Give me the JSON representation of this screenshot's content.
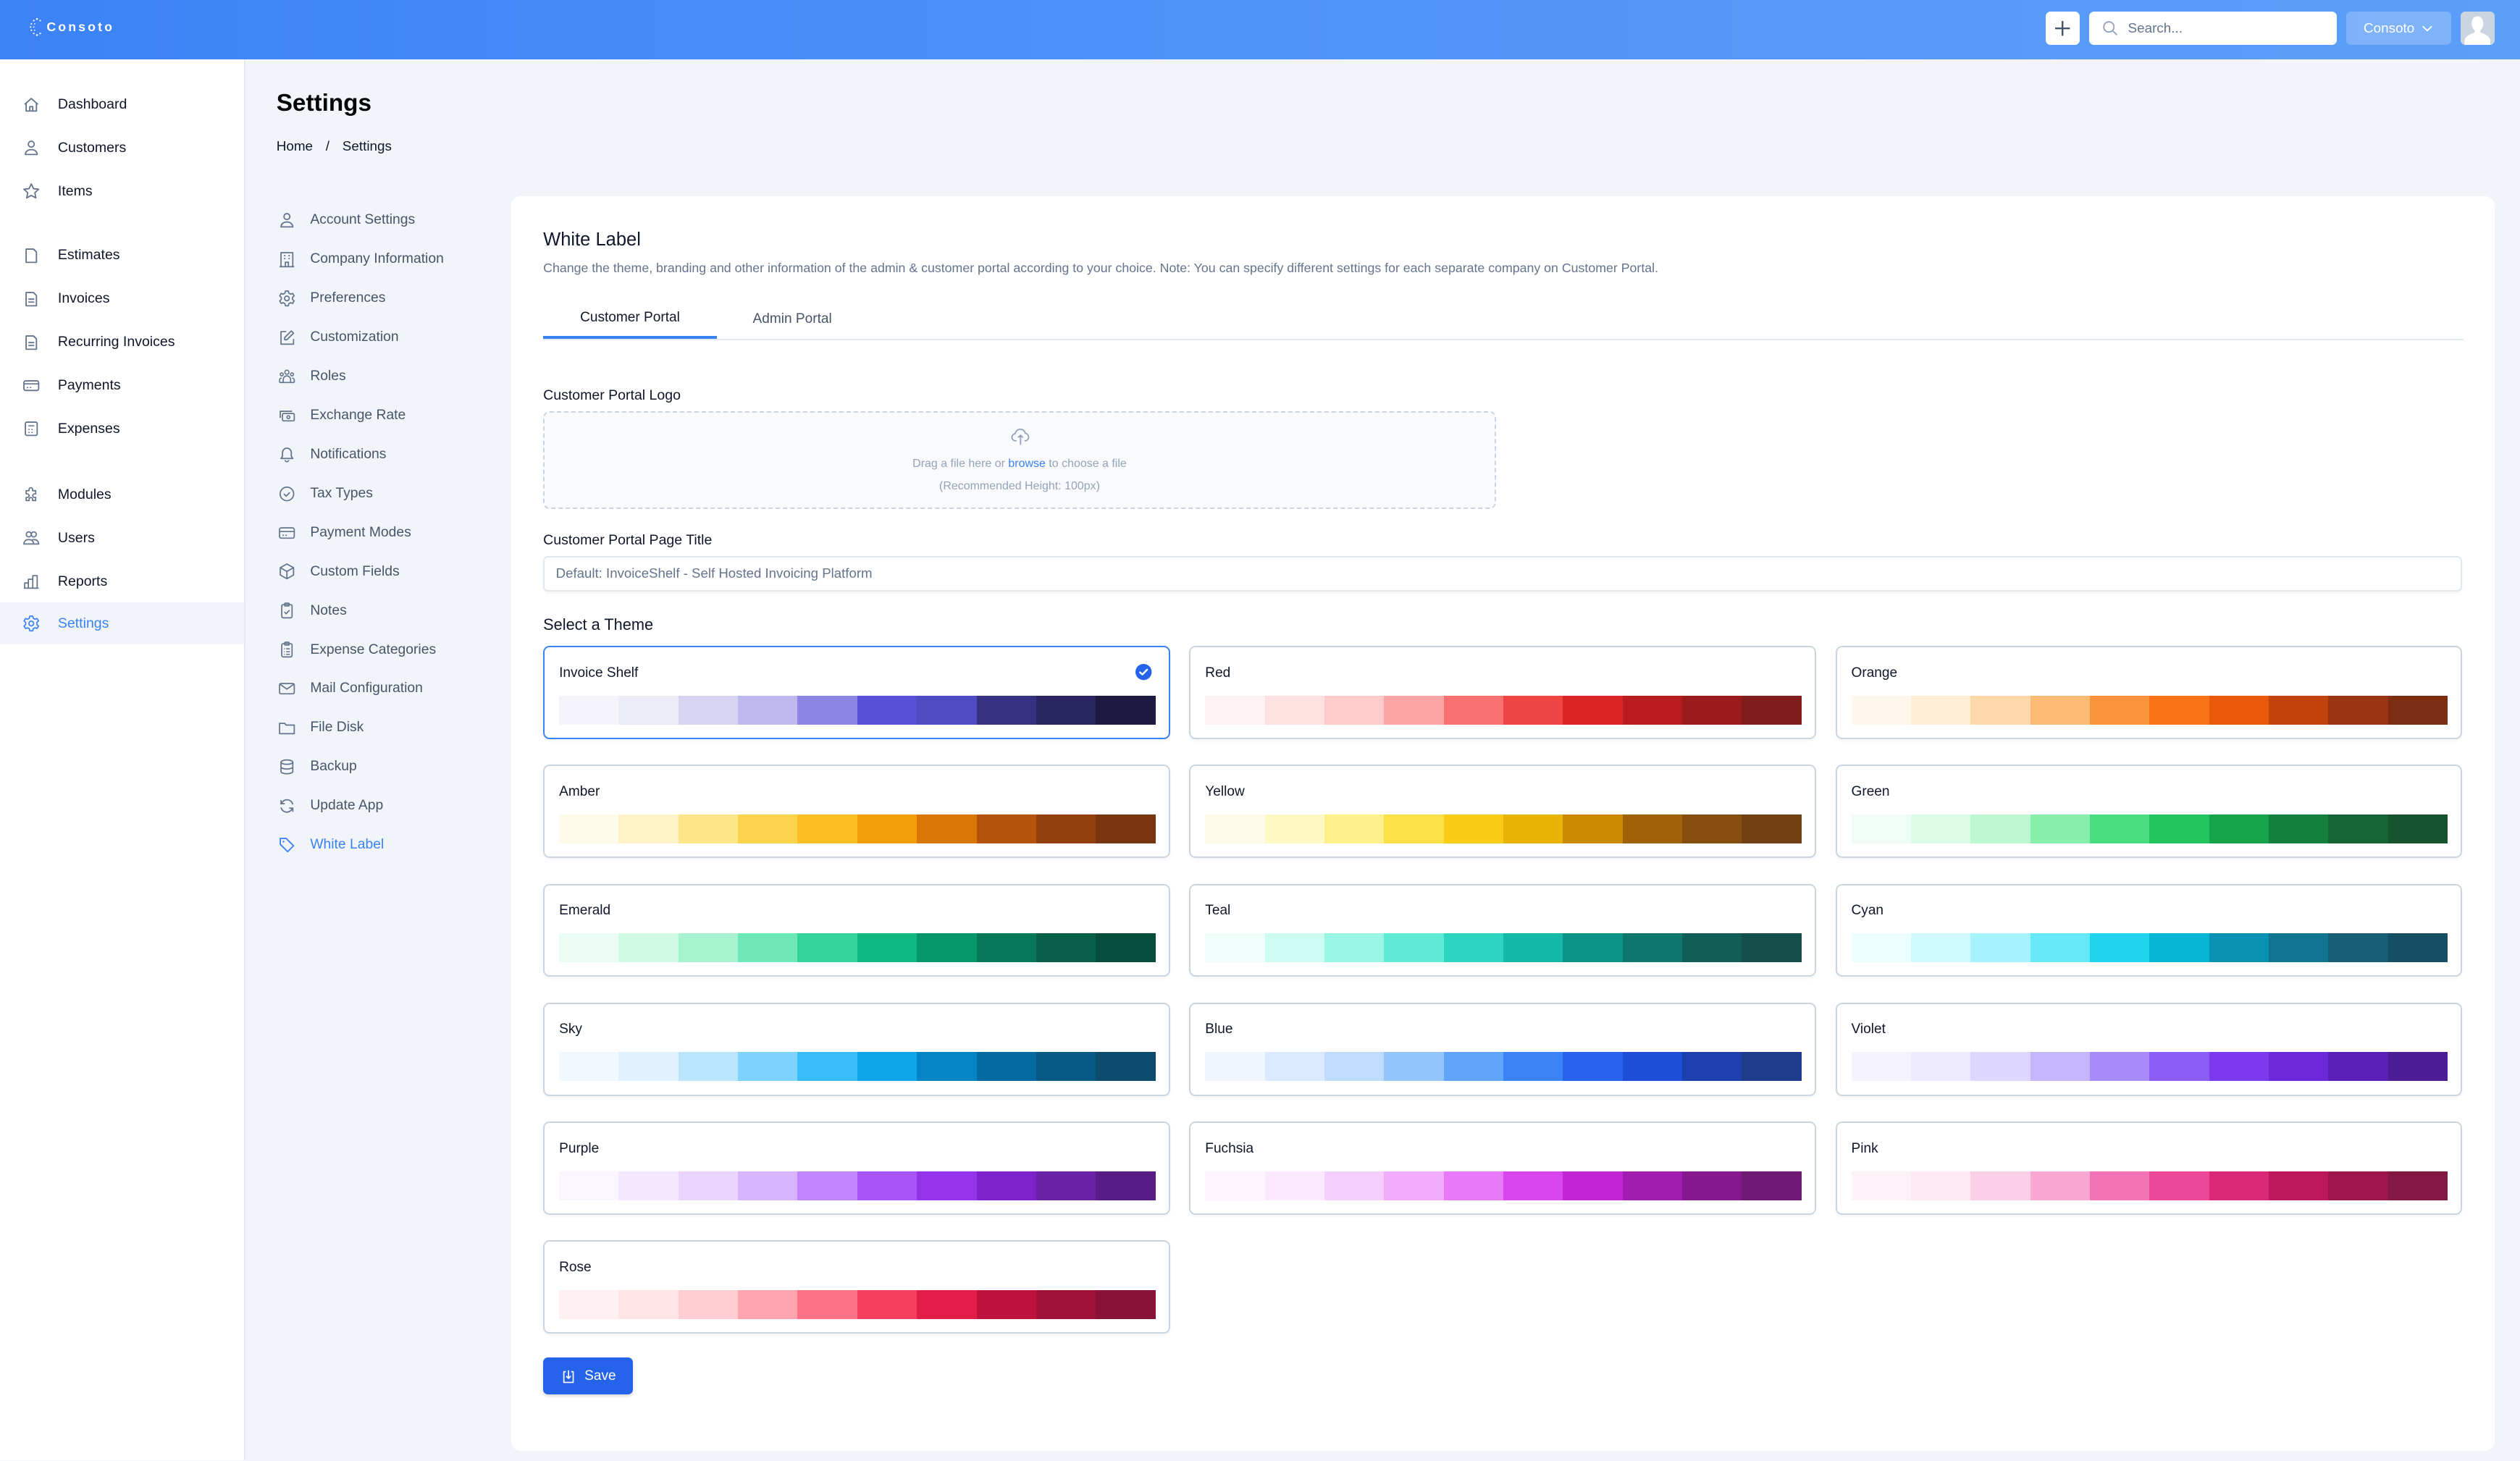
{
  "header": {
    "logo_text": "Consoto",
    "add_button_label": "+",
    "search_placeholder": "Search...",
    "company_selector": "Consoto",
    "brand_color": "#3b82f6"
  },
  "sidebar": {
    "items": [
      {
        "label": "Dashboard",
        "icon": "home-icon"
      },
      {
        "label": "Customers",
        "icon": "user-icon"
      },
      {
        "label": "Items",
        "icon": "star-icon"
      },
      {
        "label": "Estimates",
        "icon": "document-icon"
      },
      {
        "label": "Invoices",
        "icon": "document-text-icon"
      },
      {
        "label": "Recurring Invoices",
        "icon": "document-text-icon"
      },
      {
        "label": "Payments",
        "icon": "credit-card-icon"
      },
      {
        "label": "Expenses",
        "icon": "calculator-icon"
      },
      {
        "label": "Modules",
        "icon": "puzzle-icon"
      },
      {
        "label": "Users",
        "icon": "users-icon"
      },
      {
        "label": "Reports",
        "icon": "chart-bar-icon"
      },
      {
        "label": "Settings",
        "icon": "gear-icon",
        "active": true
      }
    ]
  },
  "page": {
    "title": "Settings",
    "breadcrumb": [
      "Home",
      "/",
      "Settings"
    ]
  },
  "settings_menu": {
    "items": [
      {
        "label": "Account Settings",
        "icon": "user-icon"
      },
      {
        "label": "Company Information",
        "icon": "building-icon"
      },
      {
        "label": "Preferences",
        "icon": "gear-icon"
      },
      {
        "label": "Customization",
        "icon": "pencil-square-icon"
      },
      {
        "label": "Roles",
        "icon": "user-group-icon"
      },
      {
        "label": "Exchange Rate",
        "icon": "cash-icon"
      },
      {
        "label": "Notifications",
        "icon": "bell-icon"
      },
      {
        "label": "Tax Types",
        "icon": "check-circle-icon"
      },
      {
        "label": "Payment Modes",
        "icon": "credit-card-icon"
      },
      {
        "label": "Custom Fields",
        "icon": "cube-icon"
      },
      {
        "label": "Notes",
        "icon": "clipboard-check-icon"
      },
      {
        "label": "Expense Categories",
        "icon": "clipboard-list-icon"
      },
      {
        "label": "Mail Configuration",
        "icon": "mail-icon"
      },
      {
        "label": "File Disk",
        "icon": "folder-icon"
      },
      {
        "label": "Backup",
        "icon": "database-icon"
      },
      {
        "label": "Update App",
        "icon": "refresh-icon"
      },
      {
        "label": "White Label",
        "icon": "tag-icon",
        "active": true
      }
    ]
  },
  "white_label": {
    "title": "White Label",
    "description": "Change the theme, branding and other information of the admin & customer portal according to your choice. Note: You can specify different settings for each separate company on Customer Portal.",
    "tabs": [
      {
        "label": "Customer Portal",
        "active": true
      },
      {
        "label": "Admin Portal",
        "active": false
      }
    ],
    "logo_label": "Customer Portal Logo",
    "dropzone": {
      "text_before": "Drag a file here or ",
      "link": "browse",
      "text_after": " to choose a file",
      "hint": "(Recommended Height: 100px)"
    },
    "page_title_label": "Customer Portal Page Title",
    "page_title_value": "",
    "page_title_placeholder": "Default: InvoiceShelf - Self Hosted Invoicing Platform",
    "theme_heading": "Select a Theme",
    "selected_theme": "Invoice Shelf",
    "themes": [
      {
        "name": "Invoice Shelf",
        "colors": [
          "#f5f4fb",
          "#ecebf8",
          "#d6d3f3",
          "#bdb8ee",
          "#8c85e3",
          "#5851d8",
          "#4f4bc2",
          "#353081",
          "#282561",
          "#1c1a41"
        ]
      },
      {
        "name": "Red",
        "colors": [
          "#fef2f2",
          "#fee2e2",
          "#fecaca",
          "#fca5a5",
          "#f87171",
          "#ef4444",
          "#dc2626",
          "#b91c1c",
          "#991b1b",
          "#7f1d1d"
        ]
      },
      {
        "name": "Orange",
        "colors": [
          "#fff7ed",
          "#ffedd5",
          "#fed7aa",
          "#fdba74",
          "#fb923c",
          "#f97316",
          "#ea580c",
          "#c2410c",
          "#9a3412",
          "#7c2d12"
        ]
      },
      {
        "name": "Amber",
        "colors": [
          "#fffbeb",
          "#fef3c7",
          "#fde68a",
          "#fcd34d",
          "#fbbf24",
          "#f59e0b",
          "#d97706",
          "#b45309",
          "#92400e",
          "#78350f"
        ]
      },
      {
        "name": "Yellow",
        "colors": [
          "#fefce8",
          "#fef9c3",
          "#fef08a",
          "#fde047",
          "#facc15",
          "#eab308",
          "#ca8a04",
          "#a16207",
          "#854d0e",
          "#713f12"
        ]
      },
      {
        "name": "Green",
        "colors": [
          "#f0fdf4",
          "#dcfce7",
          "#bbf7d0",
          "#86efac",
          "#4ade80",
          "#22c55e",
          "#16a34a",
          "#15803d",
          "#166534",
          "#14532d"
        ]
      },
      {
        "name": "Emerald",
        "colors": [
          "#ecfdf5",
          "#d1fae5",
          "#a7f3d0",
          "#6ee7b7",
          "#34d399",
          "#10b981",
          "#059669",
          "#047857",
          "#065f46",
          "#064e3b"
        ]
      },
      {
        "name": "Teal",
        "colors": [
          "#f0fdfa",
          "#ccfbf1",
          "#99f6e4",
          "#5eead4",
          "#2dd4bf",
          "#14b8a6",
          "#0d9488",
          "#0f766e",
          "#115e59",
          "#134e4a"
        ]
      },
      {
        "name": "Cyan",
        "colors": [
          "#ecfeff",
          "#cffafe",
          "#a5f3fc",
          "#67e8f9",
          "#22d3ee",
          "#06b6d4",
          "#0891b2",
          "#0e7490",
          "#155e75",
          "#164e63"
        ]
      },
      {
        "name": "Sky",
        "colors": [
          "#f0f9ff",
          "#e0f2fe",
          "#bae6fd",
          "#7dd3fc",
          "#38bdf8",
          "#0ea5e9",
          "#0284c7",
          "#0369a1",
          "#075985",
          "#0c4a6e"
        ]
      },
      {
        "name": "Blue",
        "colors": [
          "#eff6ff",
          "#dbeafe",
          "#bfdbfe",
          "#93c5fd",
          "#60a5fa",
          "#3b82f6",
          "#2563eb",
          "#1d4ed8",
          "#1e40af",
          "#1e3a8a"
        ]
      },
      {
        "name": "Violet",
        "colors": [
          "#f5f3ff",
          "#ede9fe",
          "#ddd6fe",
          "#c4b5fd",
          "#a78bfa",
          "#8b5cf6",
          "#7c3aed",
          "#6d28d9",
          "#5b21b6",
          "#4c1d95"
        ]
      },
      {
        "name": "Purple",
        "colors": [
          "#faf5ff",
          "#f3e8ff",
          "#e9d5ff",
          "#d8b4fe",
          "#c084fc",
          "#a855f7",
          "#9333ea",
          "#7e22ce",
          "#6b21a8",
          "#581c87"
        ]
      },
      {
        "name": "Fuchsia",
        "colors": [
          "#fdf4ff",
          "#fae8ff",
          "#f5d0fe",
          "#f0abfc",
          "#e879f9",
          "#d946ef",
          "#c026d3",
          "#a21caf",
          "#86198f",
          "#701a75"
        ]
      },
      {
        "name": "Pink",
        "colors": [
          "#fdf2f8",
          "#fce7f3",
          "#fbcfe8",
          "#f9a8d4",
          "#f472b6",
          "#ec4899",
          "#db2777",
          "#be185d",
          "#9d174d",
          "#831843"
        ]
      },
      {
        "name": "Rose",
        "colors": [
          "#fff1f2",
          "#ffe4e6",
          "#fecdd3",
          "#fda4af",
          "#fb7185",
          "#f43f5e",
          "#e11d48",
          "#be123c",
          "#9f1239",
          "#881337"
        ]
      }
    ],
    "save_label": "Save"
  }
}
